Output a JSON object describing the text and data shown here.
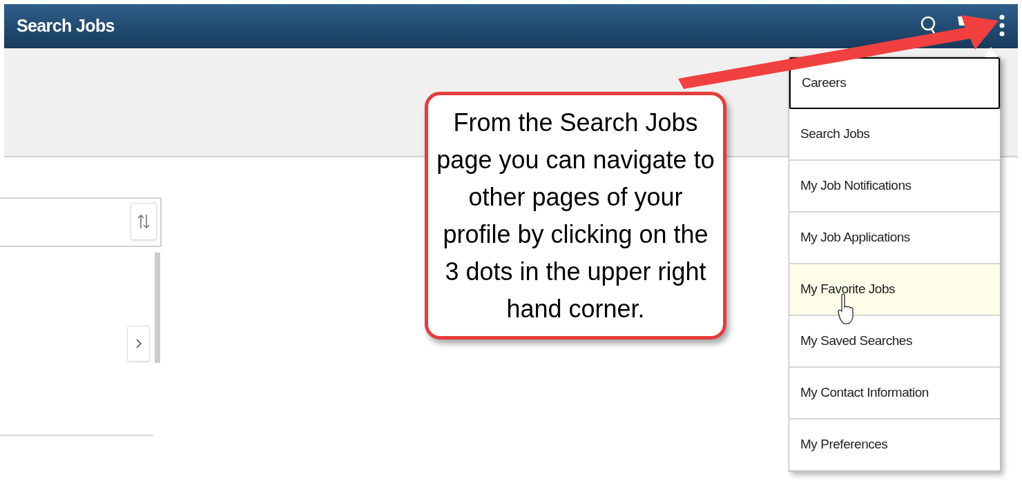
{
  "header": {
    "title": "Search Jobs"
  },
  "menu": {
    "items": [
      {
        "label": "Careers",
        "focused": true,
        "highlighted": false
      },
      {
        "label": "Search Jobs",
        "focused": false,
        "highlighted": false
      },
      {
        "label": "My Job Notifications",
        "focused": false,
        "highlighted": false
      },
      {
        "label": "My Job Applications",
        "focused": false,
        "highlighted": false
      },
      {
        "label": "My Favorite Jobs",
        "focused": false,
        "highlighted": true
      },
      {
        "label": "My Saved Searches",
        "focused": false,
        "highlighted": false
      },
      {
        "label": "My Contact Information",
        "focused": false,
        "highlighted": false
      },
      {
        "label": "My Preferences",
        "focused": false,
        "highlighted": false
      }
    ]
  },
  "callout": {
    "text": "From the Search Jobs page you can navigate to other pages of your profile by clicking on the 3 dots in the upper right hand corner."
  }
}
